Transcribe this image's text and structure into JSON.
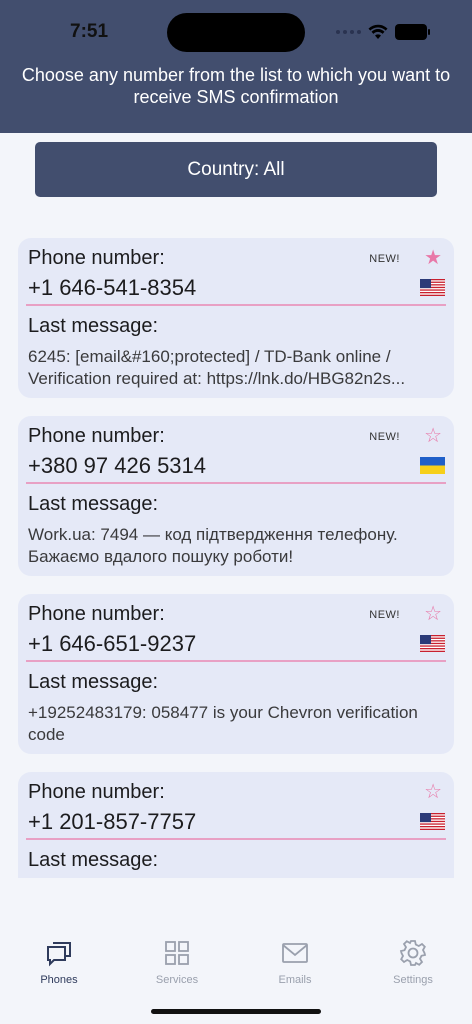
{
  "status": {
    "time": "7:51"
  },
  "header": {
    "title": "Choose any number from the list to which you want to receive SMS confirmation"
  },
  "filter": {
    "country_label": "Country: All"
  },
  "cards": [
    {
      "phone_label": "Phone number:",
      "phone": "+1 646-541-8354",
      "badge": "NEW!",
      "starred": true,
      "flag": "us-flag-icon",
      "message_label": "Last message:",
      "message": "6245: [email&#160;protected] / TD-Bank online / Verification required at: https://lnk.do/HBG82n2s..."
    },
    {
      "phone_label": "Phone number:",
      "phone": "+380 97 426 5314",
      "badge": "NEW!",
      "starred": false,
      "flag": "ukraine-flag-icon",
      "message_label": "Last message:",
      "message": "Work.ua: 7494 — код підтвердження телефону. Бажаємо вдалого пошуку роботи!"
    },
    {
      "phone_label": "Phone number:",
      "phone": "+1 646-651-9237",
      "badge": "NEW!",
      "starred": false,
      "flag": "us-flag-icon",
      "message_label": "Last message:",
      "message": "+19252483179: 058477 is your Chevron verification code"
    },
    {
      "phone_label": "Phone number:",
      "phone": "+1 201-857-7757",
      "badge": "",
      "starred": false,
      "flag": "us-flag-icon",
      "message_label": "Last message:",
      "message": ""
    }
  ],
  "tabs": [
    {
      "label": "Phones",
      "icon": "chat-bubbles-icon",
      "active": true
    },
    {
      "label": "Services",
      "icon": "grid-icon",
      "active": false
    },
    {
      "label": "Emails",
      "icon": "envelope-icon",
      "active": false
    },
    {
      "label": "Settings",
      "icon": "gear-icon",
      "active": false
    }
  ],
  "colors": {
    "header": "#424e6e",
    "card": "#e5e9f7",
    "accent_pink": "#e878a8",
    "separator": "#e8a0c4",
    "tab_active": "#2f3b5c",
    "tab_inactive": "#9aa0ad"
  }
}
